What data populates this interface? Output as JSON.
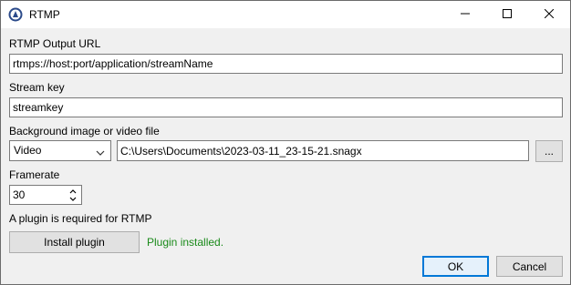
{
  "window": {
    "title": "RTMP",
    "minimize_icon": "minimize-icon",
    "maximize_icon": "maximize-icon",
    "close_icon": "close-icon",
    "app_icon": "app-logo-icon"
  },
  "form": {
    "url_label": "RTMP Output URL",
    "url_value": "rtmps://host:port/application/streamName",
    "key_label": "Stream key",
    "key_value": "streamkey",
    "background_label": "Background image or video file",
    "background_type": "Video",
    "background_path": "C:\\Users\\Documents\\2023-03-11_23-15-21.snagx",
    "browse_label": "...",
    "framerate_label": "Framerate",
    "framerate_value": "30",
    "plugin_notice": "A plugin is required for RTMP",
    "install_label": "Install plugin",
    "plugin_status": "Plugin installed."
  },
  "footer": {
    "ok_label": "OK",
    "cancel_label": "Cancel"
  },
  "colors": {
    "status_success": "#1a8a1a",
    "default_button_border": "#0078d7"
  }
}
